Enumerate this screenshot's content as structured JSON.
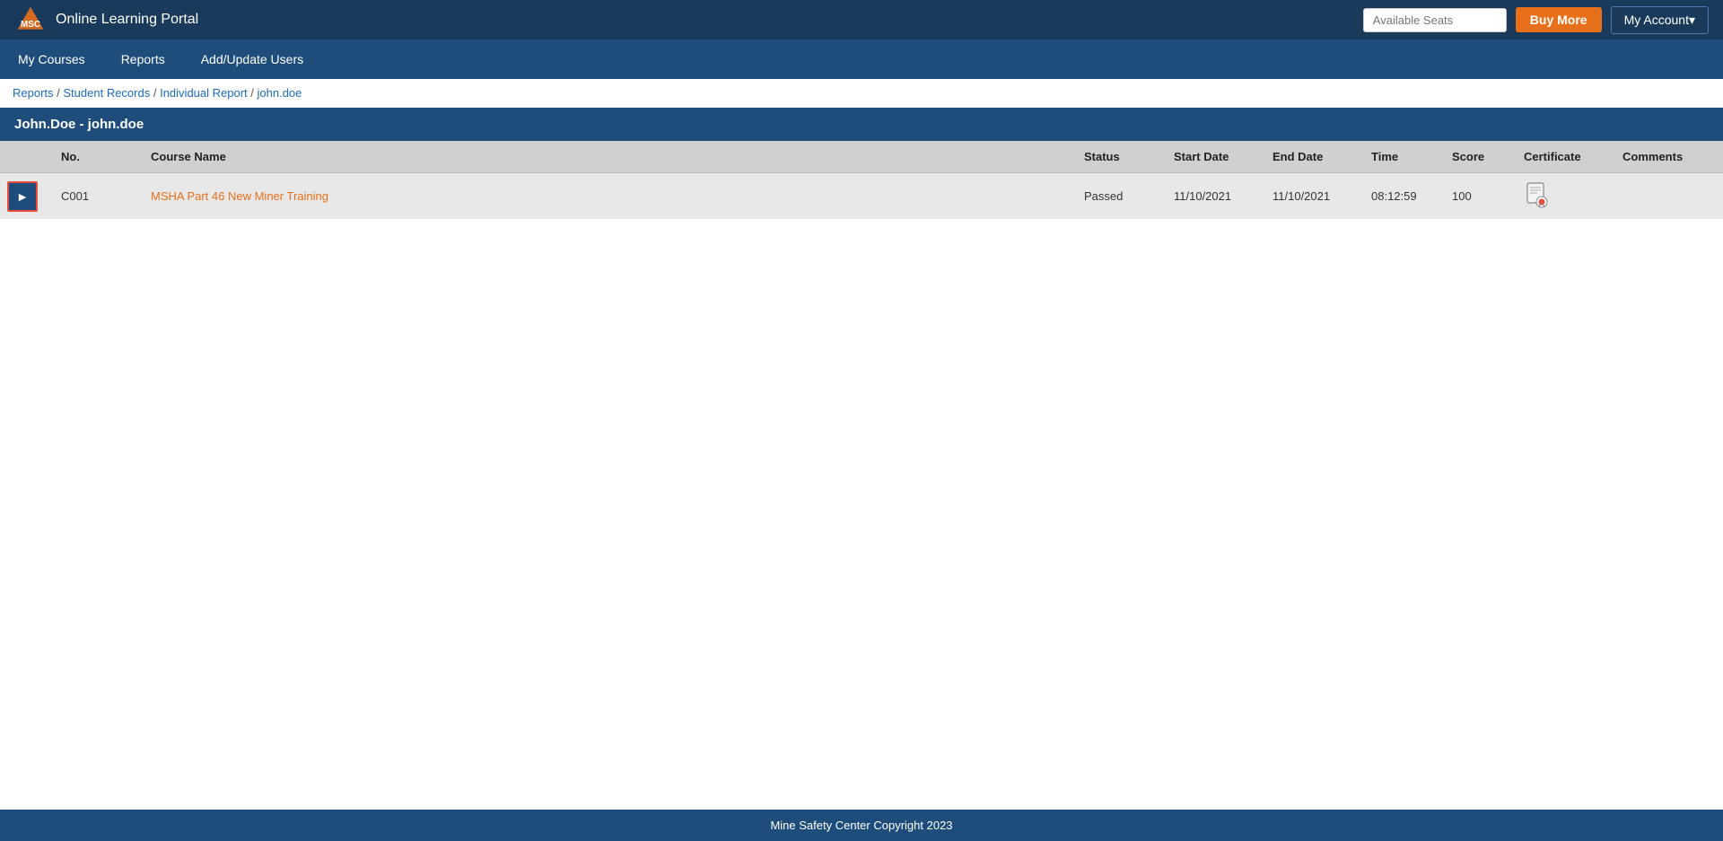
{
  "header": {
    "logo_text": "MSC",
    "portal_title": "Online Learning Portal",
    "available_seats_label": "Available Seats",
    "available_seats_placeholder": "Available Seats",
    "buy_more_label": "Buy More",
    "my_account_label": "My Account▾"
  },
  "nav": {
    "items": [
      {
        "label": "My Courses",
        "id": "my-courses"
      },
      {
        "label": "Reports",
        "id": "reports"
      },
      {
        "label": "Add/Update Users",
        "id": "add-update-users"
      }
    ]
  },
  "breadcrumb": {
    "items": [
      {
        "label": "Reports",
        "href": "#"
      },
      {
        "label": "Student Records",
        "href": "#"
      },
      {
        "label": "Individual Report",
        "href": "#"
      },
      {
        "label": "john.doe",
        "href": "#"
      }
    ]
  },
  "section": {
    "title": "John.Doe - john.doe"
  },
  "table": {
    "columns": [
      {
        "key": "expand",
        "label": ""
      },
      {
        "key": "no",
        "label": "No."
      },
      {
        "key": "course_name",
        "label": "Course Name"
      },
      {
        "key": "status",
        "label": "Status"
      },
      {
        "key": "start_date",
        "label": "Start Date"
      },
      {
        "key": "end_date",
        "label": "End Date"
      },
      {
        "key": "time",
        "label": "Time"
      },
      {
        "key": "score",
        "label": "Score"
      },
      {
        "key": "certificate",
        "label": "Certificate"
      },
      {
        "key": "comments",
        "label": "Comments"
      }
    ],
    "rows": [
      {
        "no": "C001",
        "course_name": "MSHA Part 46 New Miner Training",
        "status": "Passed",
        "start_date": "11/10/2021",
        "end_date": "11/10/2021",
        "time": "08:12:59",
        "score": "100",
        "has_certificate": true,
        "comments": ""
      }
    ]
  },
  "footer": {
    "text": "Mine Safety Center Copyright 2023"
  }
}
